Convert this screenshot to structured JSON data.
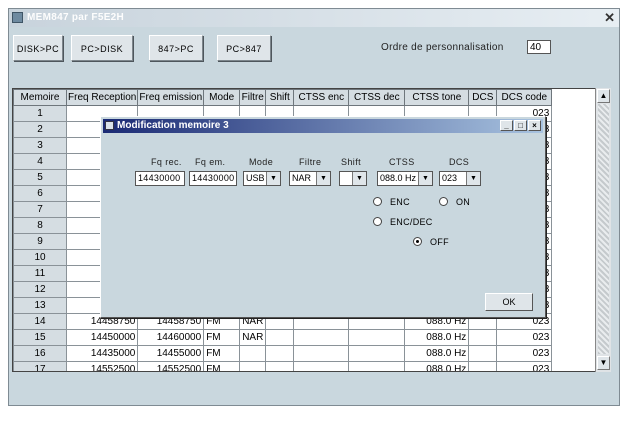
{
  "window": {
    "title": "MEM847 par F5E2H",
    "close_glyph": "✕"
  },
  "toolbar": {
    "buttons": [
      "DISK>PC",
      "PC>DISK",
      "847>PC",
      "PC>847"
    ],
    "pers_label": "Ordre de personnalisation",
    "pers_value": "40"
  },
  "grid": {
    "columns": [
      "Memoire",
      "Freq Reception",
      "Freq emission",
      "Mode",
      "Filtre",
      "Shift",
      "CTSS enc",
      "CTSS dec",
      "CTSS tone",
      "DCS",
      "DCS code"
    ],
    "rows": [
      {
        "n": "1",
        "rx": "",
        "tx": "",
        "mode": "",
        "filtre": "",
        "tone": "",
        "dcs": "023"
      },
      {
        "n": "2",
        "rx": "",
        "tx": "",
        "mode": "",
        "filtre": "",
        "tone": "",
        "dcs": "023"
      },
      {
        "n": "3",
        "rx": "",
        "tx": "",
        "mode": "",
        "filtre": "",
        "tone": "",
        "dcs": "023"
      },
      {
        "n": "4",
        "rx": "",
        "tx": "",
        "mode": "",
        "filtre": "",
        "tone": "",
        "dcs": "023"
      },
      {
        "n": "5",
        "rx": "",
        "tx": "",
        "mode": "",
        "filtre": "",
        "tone": "",
        "dcs": "023"
      },
      {
        "n": "6",
        "rx": "",
        "tx": "",
        "mode": "",
        "filtre": "",
        "tone": "",
        "dcs": "023"
      },
      {
        "n": "7",
        "rx": "",
        "tx": "",
        "mode": "",
        "filtre": "",
        "tone": "",
        "dcs": "023"
      },
      {
        "n": "8",
        "rx": "",
        "tx": "",
        "mode": "",
        "filtre": "",
        "tone": "",
        "dcs": "023"
      },
      {
        "n": "9",
        "rx": "",
        "tx": "",
        "mode": "",
        "filtre": "",
        "tone": "",
        "dcs": "023"
      },
      {
        "n": "10",
        "rx": "",
        "tx": "",
        "mode": "",
        "filtre": "",
        "tone": "",
        "dcs": "023"
      },
      {
        "n": "11",
        "rx": "",
        "tx": "",
        "mode": "",
        "filtre": "",
        "tone": "",
        "dcs": "023"
      },
      {
        "n": "12",
        "rx": "",
        "tx": "",
        "mode": "",
        "filtre": "",
        "tone": "",
        "dcs": "023"
      },
      {
        "n": "13",
        "rx": "",
        "tx": "",
        "mode": "",
        "filtre": "",
        "tone": "",
        "dcs": "023"
      },
      {
        "n": "14",
        "rx": "14458750",
        "tx": "14458750",
        "mode": "FM",
        "filtre": "NAR",
        "tone": "088.0 Hz",
        "dcs": "023"
      },
      {
        "n": "15",
        "rx": "14450000",
        "tx": "14460000",
        "mode": "FM",
        "filtre": "NAR",
        "tone": "088.0 Hz",
        "dcs": "023"
      },
      {
        "n": "16",
        "rx": "14435000",
        "tx": "14455000",
        "mode": "FM",
        "filtre": "",
        "tone": "088.0 Hz",
        "dcs": "023"
      },
      {
        "n": "17",
        "rx": "14552500",
        "tx": "14552500",
        "mode": "FM",
        "filtre": "",
        "tone": "088.0 Hz",
        "dcs": "023"
      }
    ]
  },
  "dialog": {
    "title": "Modification memoire 3",
    "min": "_",
    "max": "□",
    "close": "×",
    "labels": {
      "rx": "Fq rec.",
      "tx": "Fq em.",
      "mode": "Mode",
      "filtre": "Filtre",
      "shift": "Shift",
      "ctss": "CTSS",
      "dcs": "DCS"
    },
    "values": {
      "rx": "14430000",
      "tx": "14430000",
      "mode": "USB",
      "filtre": "NAR",
      "shift": "",
      "ctss": "088.0 Hz",
      "dcs": "023"
    },
    "radios": [
      {
        "label": "ENC",
        "selected": false
      },
      {
        "label": "ON",
        "selected": false
      },
      {
        "label": "ENC/DEC",
        "selected": false
      },
      {
        "label": "OFF",
        "selected": true
      }
    ],
    "ok": "OK"
  },
  "icons": {
    "dropdown": "▼",
    "scroll_up": "▲",
    "scroll_down": "▼"
  }
}
